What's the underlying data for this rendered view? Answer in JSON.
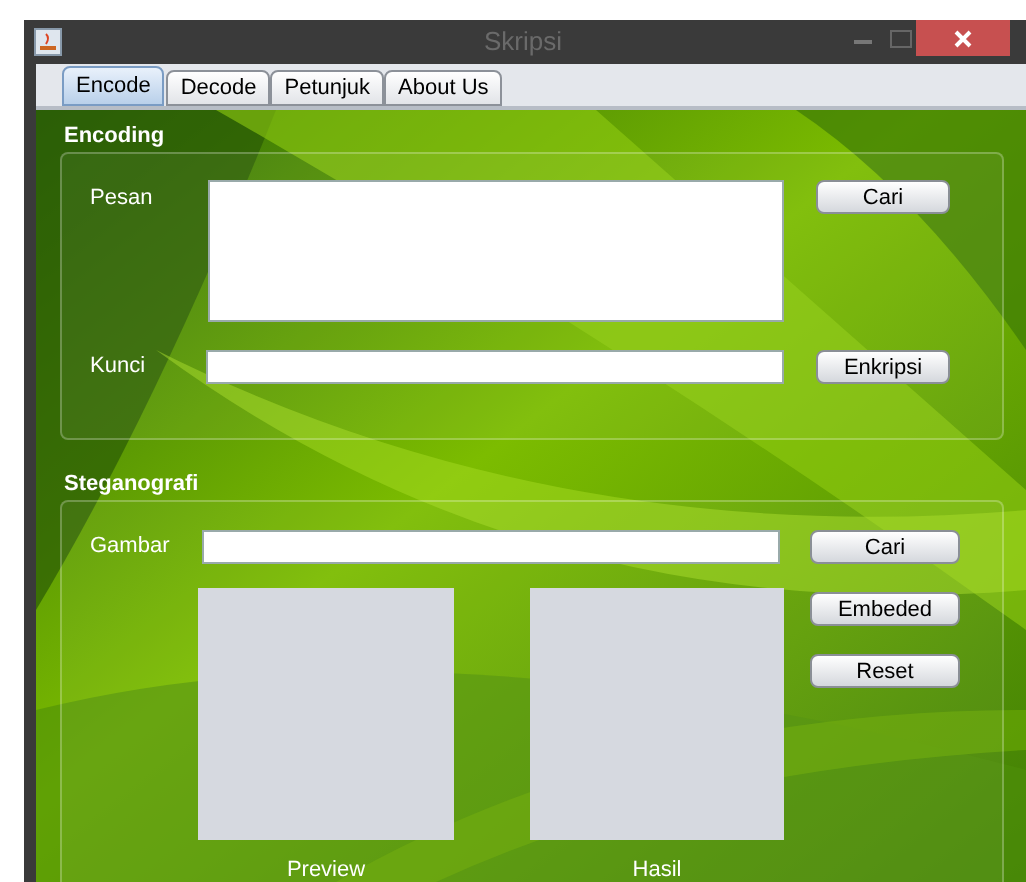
{
  "window": {
    "title": "Skripsi"
  },
  "tabs": [
    {
      "label": "Encode",
      "selected": true
    },
    {
      "label": "Decode",
      "selected": false
    },
    {
      "label": "Petunjuk",
      "selected": false
    },
    {
      "label": "About Us",
      "selected": false
    }
  ],
  "encoding": {
    "title": "Encoding",
    "message_label": "Pesan",
    "browse_button": "Cari",
    "key_label": "Kunci",
    "encrypt_button": "Enkripsi"
  },
  "steganography": {
    "title": "Steganografi",
    "image_label": "Gambar",
    "browse_button": "Cari",
    "buttons": [
      "Embeded",
      "Reset"
    ],
    "preview_caption": "Preview",
    "result_caption": "Hasil"
  }
}
